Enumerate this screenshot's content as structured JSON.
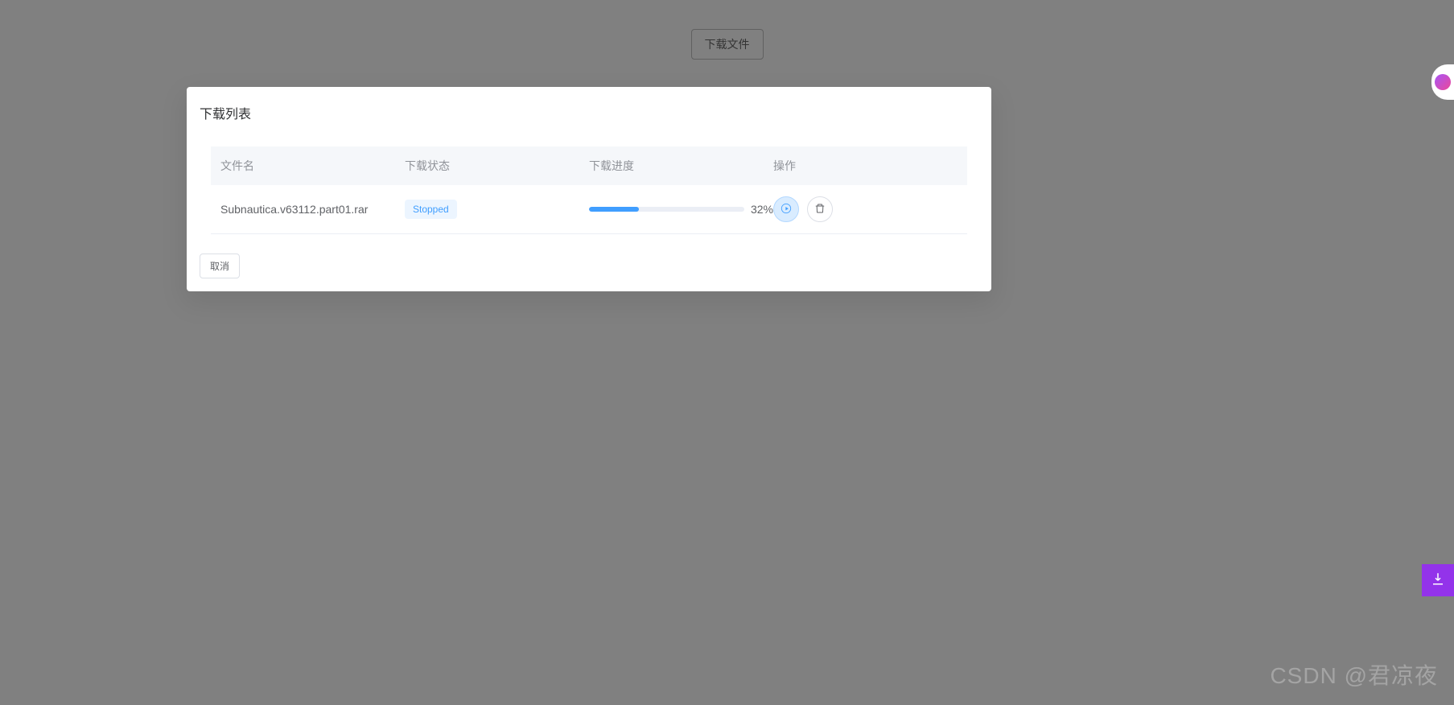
{
  "top_button_label": "下载文件",
  "dialog": {
    "title": "下载列表",
    "columns": {
      "filename": "文件名",
      "status": "下载状态",
      "progress": "下载进度",
      "actions": "操作"
    },
    "row": {
      "filename": "Subnautica.v63112.part01.rar",
      "status": "Stopped",
      "progress_pct": 32,
      "progress_text": "32%"
    },
    "cancel_label": "取消"
  },
  "watermark": "CSDN @君凉夜"
}
